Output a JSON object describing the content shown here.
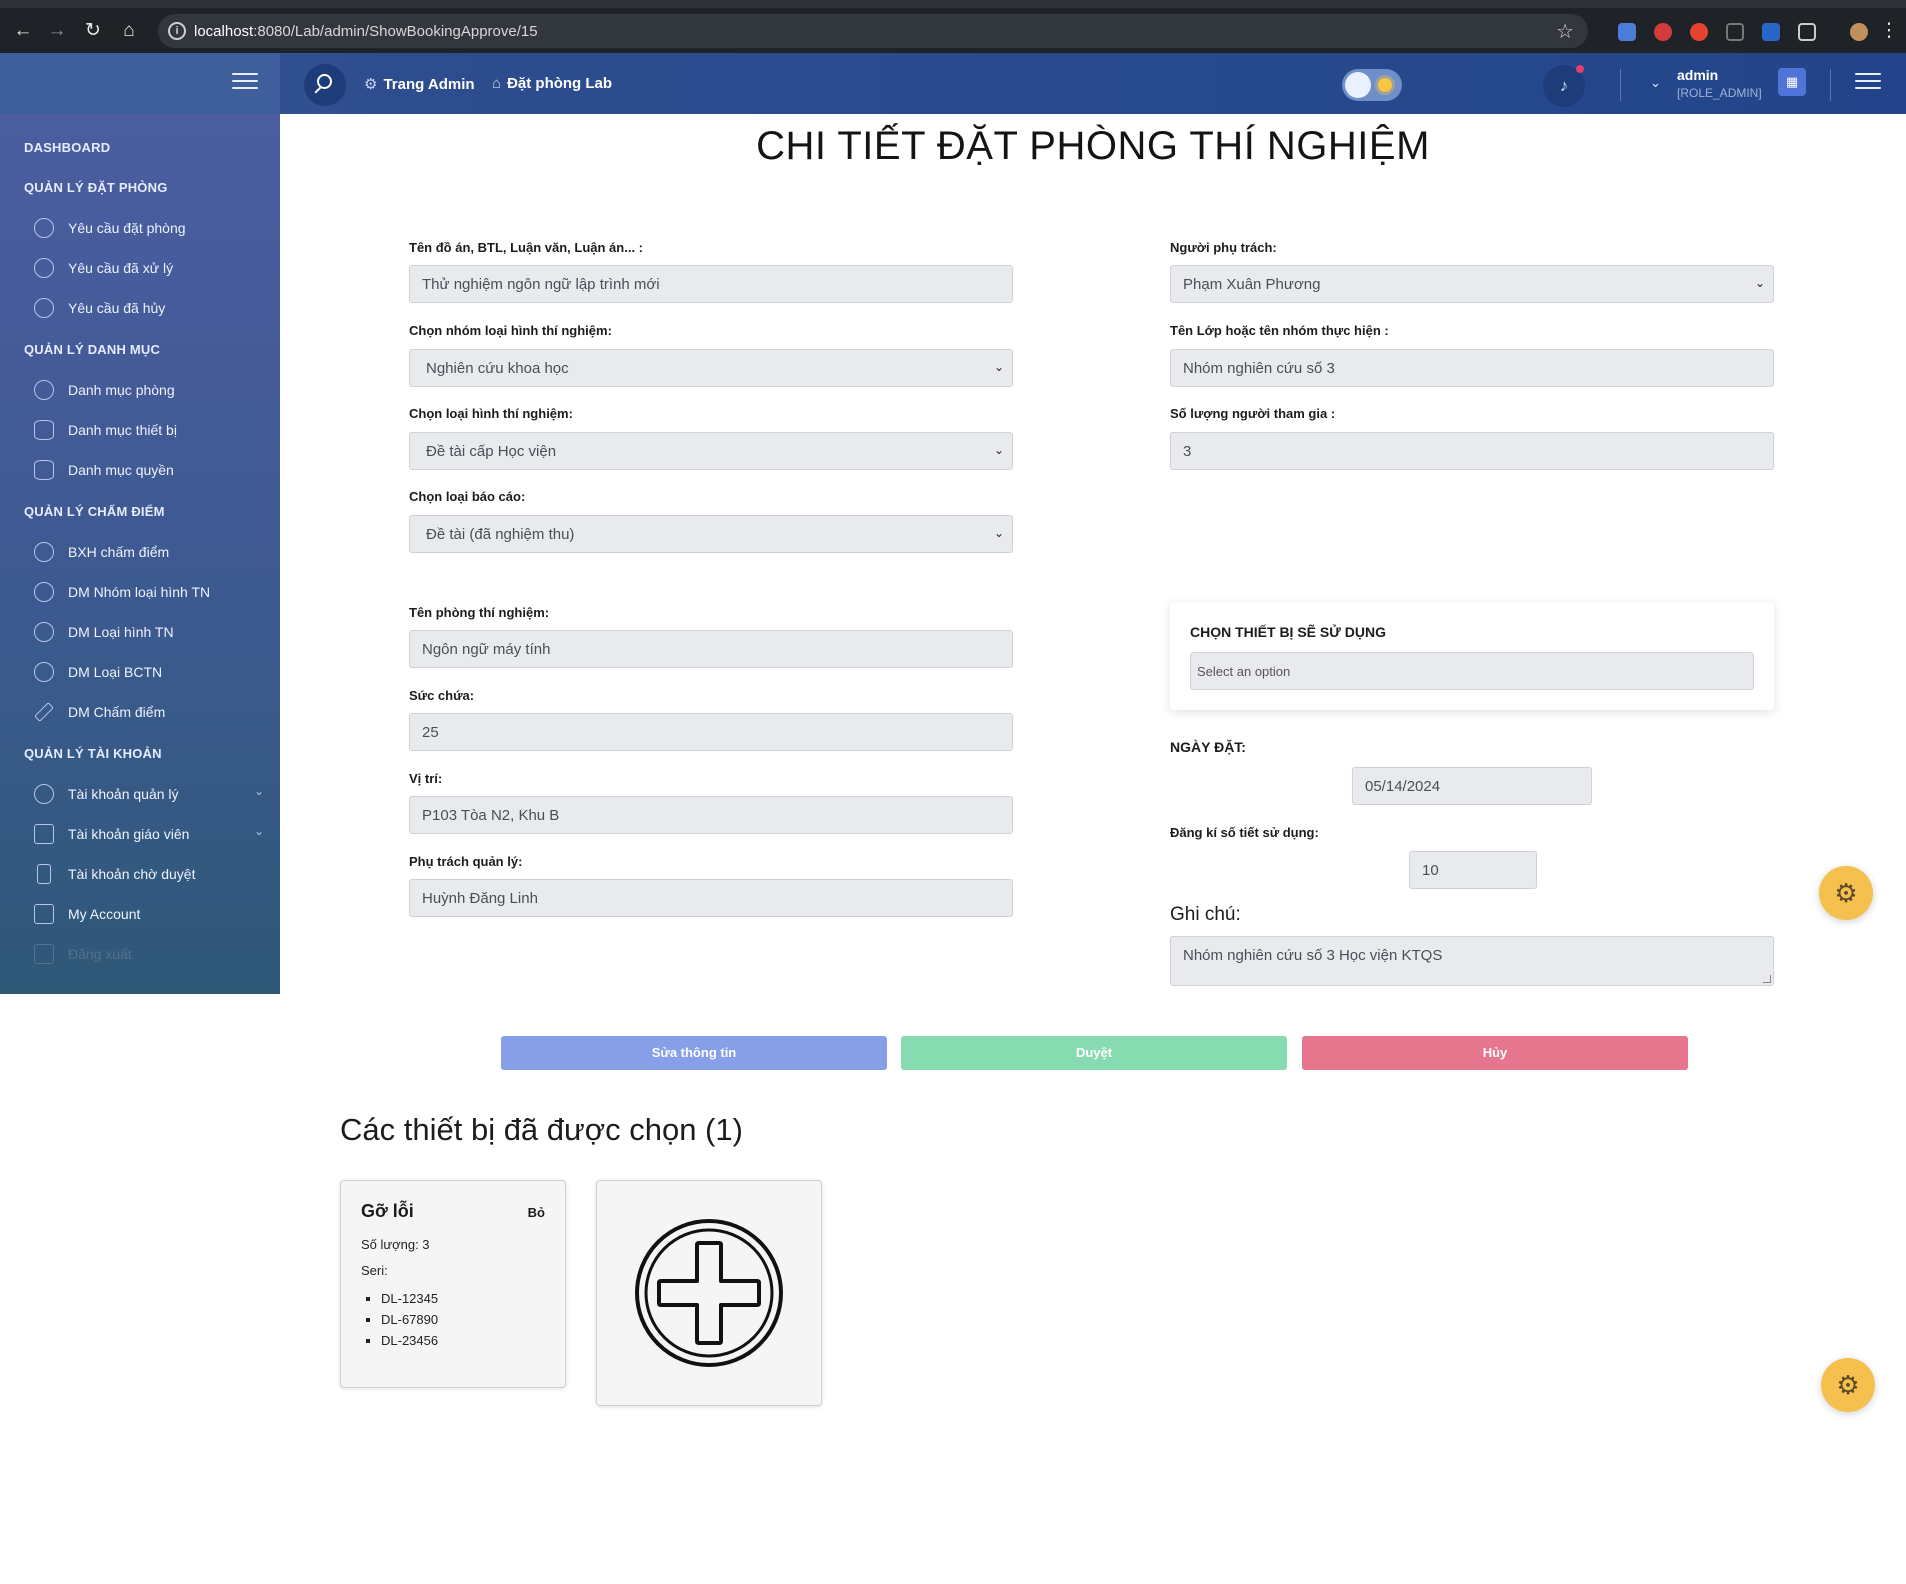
{
  "browser": {
    "url_host": "localhost",
    "url_rest": ":8080/Lab/admin/ShowBookingApprove/15"
  },
  "header": {
    "links": [
      "Trang Admin",
      "Đặt phòng Lab"
    ],
    "user": {
      "name": "admin",
      "role": "[ROLE_ADMIN]"
    }
  },
  "sidebar": {
    "dashboard": "DASHBOARD",
    "sections": [
      {
        "title": "QUẢN LÝ ĐẶT PHÒNG",
        "items": [
          "Yêu cầu đặt phòng",
          "Yêu cầu đã xử lý",
          "Yêu cầu đã hủy"
        ]
      },
      {
        "title": "QUẢN LÝ DANH MỤC",
        "items": [
          "Danh mục phòng",
          "Danh mục thiết bị",
          "Danh mục quyền"
        ]
      },
      {
        "title": "QUẢN LÝ CHẤM ĐIỂM",
        "items": [
          "BXH chấm điểm",
          "DM Nhóm loại hình TN",
          "DM Loại hình TN",
          "DM Loại BCTN",
          "DM Chấm điểm"
        ]
      },
      {
        "title": "QUẢN LÝ TÀI KHOẢN",
        "items": [
          "Tài khoản quản lý",
          "Tài khoản giáo viên",
          "Tài khoản chờ duyệt",
          "My Account",
          "Đăng xuất"
        ]
      }
    ]
  },
  "page": {
    "title": "CHI TIẾT ĐẶT PHÒNG THÍ NGHIỆM",
    "left": {
      "project_label": "Tên đồ án, BTL, Luận văn, Luận án... :",
      "project_value": "Thử nghiệm ngôn ngữ lập trình mới",
      "group_label": "Chọn nhóm loại hình thí nghiệm:",
      "group_value": "Nghiên cứu khoa học",
      "type_label": "Chọn loại hình thí nghiệm:",
      "type_value": "Đề tài cấp Học viện",
      "report_label": "Chọn loại báo cáo:",
      "report_value": "Đề tài (đã nghiệm thu)",
      "room_label": "Tên phòng thí nghiệm:",
      "room_value": "Ngôn ngữ máy tính",
      "capacity_label": "Sức chứa:",
      "capacity_value": "25",
      "location_label": "Vị trí:",
      "location_value": "P103 Tòa N2, Khu B",
      "manager_label": "Phụ trách quản lý:",
      "manager_value": "Huỳnh Đăng Linh"
    },
    "right": {
      "person_label": "Người phụ trách:",
      "person_value": "Phạm Xuân Phương",
      "class_label": "Tên Lớp hoặc tên nhóm thực hiện :",
      "class_value": "Nhóm nghiên cứu số 3",
      "count_label": "Số lượng người tham gia :",
      "count_value": "3",
      "equip_title": "CHỌN THIẾT BỊ SẼ SỬ DỤNG",
      "equip_placeholder": "Select an option",
      "date_label": "NGÀY ĐẶT:",
      "date_value": "05/14/2024",
      "periods_label": "Đăng kí số tiết sử dụng:",
      "periods_value": "10",
      "note_label": "Ghi chú:",
      "note_value": "Nhóm nghiên cứu số 3 Học viện KTQS"
    },
    "buttons": {
      "edit": "Sửa thông tin",
      "approve": "Duyệt",
      "cancel": "Hủy"
    },
    "selected_title": "Các thiết bị đã được chọn (1)",
    "devices": [
      {
        "name": "Gỡ lỗi",
        "remove": "Bỏ",
        "qty": "Số lượng: 3",
        "seri_label": "Seri:",
        "serials": [
          "DL-12345",
          "DL-67890",
          "DL-23456"
        ]
      }
    ]
  }
}
